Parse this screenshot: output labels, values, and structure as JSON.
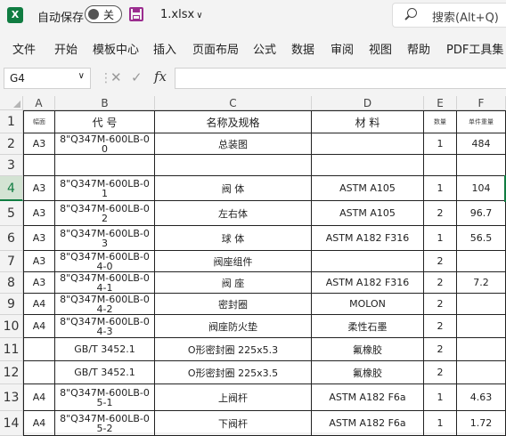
{
  "titlebar": {
    "app_icon": "X",
    "autosave_label": "自动保存",
    "autosave_state": "关",
    "filename": "1.xlsx",
    "search_placeholder": "搜索(Alt+Q)"
  },
  "ribbon": {
    "tabs": [
      "文件",
      "开始",
      "模板中心",
      "插入",
      "页面布局",
      "公式",
      "数据",
      "审阅",
      "视图",
      "帮助",
      "PDF工具集"
    ]
  },
  "formula_bar": {
    "name_box": "G4",
    "fx": "fx",
    "value": ""
  },
  "sheet": {
    "col_headers": [
      "A",
      "B",
      "C",
      "D",
      "E",
      "F"
    ],
    "row_headers": [
      "1",
      "2",
      "3",
      "4",
      "5",
      "6",
      "7",
      "8",
      "9",
      "10",
      "11",
      "12",
      "13",
      "14"
    ],
    "selected_row": "4",
    "header_row": [
      "幅面",
      "代 号",
      "名称及规格",
      "材 料",
      "数量",
      "单件重量"
    ],
    "rows": [
      [
        "A3",
        "8\"Q347M-600LB-00",
        "总装图",
        "",
        "1",
        "484"
      ],
      [
        "",
        "",
        "",
        "",
        "",
        ""
      ],
      [
        "A3",
        "8\"Q347M-600LB-01",
        "阀 体",
        "ASTM A105",
        "1",
        "104"
      ],
      [
        "A3",
        "8\"Q347M-600LB-02",
        "左右体",
        "ASTM A105",
        "2",
        "96.7"
      ],
      [
        "A3",
        "8\"Q347M-600LB-03",
        "球 体",
        "ASTM A182 F316",
        "1",
        "56.5"
      ],
      [
        "A3",
        "8\"Q347M-600LB-04-0",
        "阀座组件",
        "",
        "2",
        ""
      ],
      [
        "A3",
        "8\"Q347M-600LB-04-1",
        "阀 座",
        "ASTM A182 F316",
        "2",
        "7.2"
      ],
      [
        "A4",
        "8\"Q347M-600LB-04-2",
        "密封圈",
        "MOLON",
        "2",
        ""
      ],
      [
        "A4",
        "8\"Q347M-600LB-04-3",
        "阀座防火垫",
        "柔性石墨",
        "2",
        ""
      ],
      [
        "",
        "GB/T 3452.1",
        "O形密封圈 225x5.3",
        "氟橡胶",
        "2",
        ""
      ],
      [
        "",
        "GB/T 3452.1",
        "O形密封圈 225x3.5",
        "氟橡胶",
        "2",
        ""
      ],
      [
        "A4",
        "8\"Q347M-600LB-05-1",
        "上阀杆",
        "ASTM A182 F6a",
        "1",
        "4.63"
      ],
      [
        "A4",
        "8\"Q347M-600LB-05-2",
        "下阀杆",
        "ASTM A182 F6a",
        "1",
        "1.72"
      ]
    ]
  }
}
